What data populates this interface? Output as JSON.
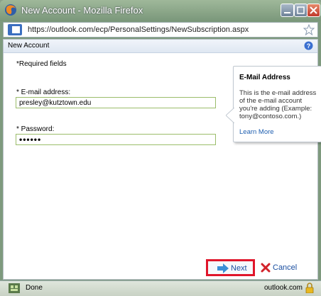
{
  "window": {
    "title": "New Account - Mozilla Firefox"
  },
  "address_bar": {
    "url": "https://outlook.com/ecp/PersonalSettings/NewSubscription.aspx"
  },
  "panel": {
    "header": "New Account",
    "required_note": "*Required fields"
  },
  "form": {
    "email_label": "* E-mail address:",
    "email_value": "presley@kutztown.edu",
    "password_label": "* Password:",
    "password_mask": "••••••"
  },
  "callout": {
    "title": "E-Mail Address",
    "body": "This is the e-mail address of the e-mail account you're adding (Example: tony@contoso.com.)",
    "link": "Learn More"
  },
  "buttons": {
    "next": "Next",
    "cancel": "Cancel"
  },
  "status": {
    "text": "Done",
    "domain": "outlook.com"
  },
  "colors": {
    "highlight": "#e0152a",
    "link": "#1f5fb0",
    "input_border": "#9bbd6a"
  }
}
